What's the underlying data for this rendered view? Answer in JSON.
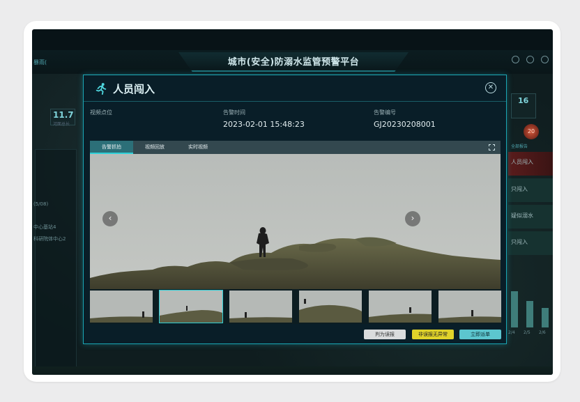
{
  "dashboard": {
    "title": "城市(安全)防溺水监管预警平台",
    "left_header_text": "暴雨(",
    "left_stat_value": "11.7",
    "left_stat_label": "河面总长",
    "left_list": [
      "(5/08)",
      "中心基站4",
      "科研院体中心2"
    ],
    "right_stat_value": "16",
    "right_alarm_value": "20",
    "right_panel_items": [
      "人员闯入",
      "只闯入",
      "疑似溺水",
      "只闯入"
    ],
    "right_link": "全部报告",
    "right_bar_labels": [
      "2/4",
      "2/5",
      "2/6"
    ]
  },
  "modal": {
    "title": "人员闯入",
    "info": {
      "video_point_label": "视频点位",
      "alarm_time_label": "告警时间",
      "alarm_time_value": "2023-02-01 15:48:23",
      "alarm_no_label": "告警编号",
      "alarm_no_value": "GJ20230208001"
    },
    "tabs": [
      "告警抓拍",
      "视频回放",
      "实时视频"
    ],
    "active_tab": "告警抓拍",
    "thumbnail_count": 6,
    "selected_thumbnail": 2,
    "buttons": {
      "misjudge": "判为误报",
      "normal": "非误报无异常",
      "dispatch": "立即派单"
    }
  },
  "colors": {
    "accent": "#1aa7b5",
    "active_tab": "#2c6f78",
    "alarm_red": "#d0563a",
    "button_yellow": "#e0d32a",
    "button_cyan": "#5cc6cf"
  },
  "icons": [
    "running-person-icon",
    "close-icon",
    "fullscreen-icon",
    "chevron-left-icon",
    "chevron-right-icon",
    "settings-icon",
    "clock-icon",
    "user-icon"
  ]
}
